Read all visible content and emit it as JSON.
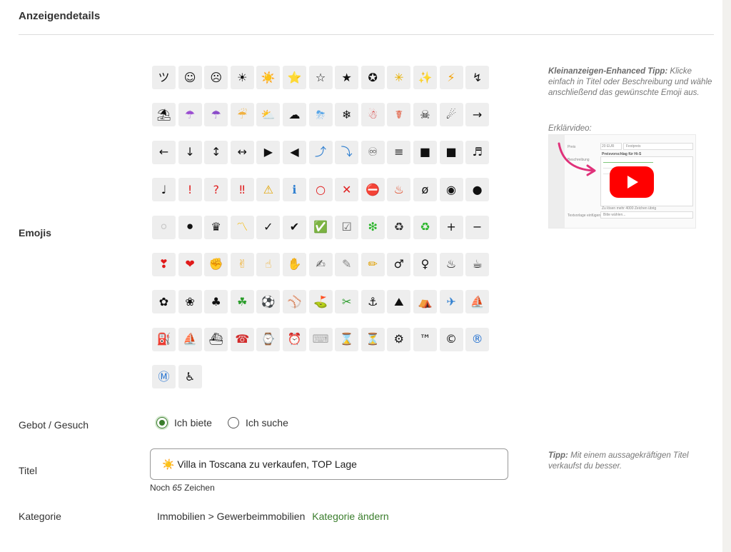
{
  "section": {
    "title": "Anzeigendetails"
  },
  "emojis": {
    "label": "Emojis",
    "items": [
      "ツ",
      "☺",
      "☹",
      "☀",
      "☀️",
      "⭐",
      "☆",
      "★",
      "✪",
      "✳",
      "✨",
      "⚡",
      "↯",
      "⛱",
      "☂",
      "☂",
      "☔",
      "⛅",
      "☁",
      "⛈",
      "❄",
      "☃",
      "☤",
      "☠",
      "☄",
      "→",
      "←",
      "↓",
      "↕",
      "↔",
      "▶",
      "◀",
      "⤴",
      "⤵",
      "♾",
      "≡",
      "■",
      "■",
      "♬",
      "♩",
      "!",
      "?",
      "‼",
      "⚠",
      "ℹ",
      "○",
      "✕",
      "⛔",
      "♨",
      "ø",
      "◉",
      "●",
      "⚪",
      "⚫",
      "♛",
      "〽",
      "✓",
      "✔",
      "✅",
      "☑",
      "❇",
      "♻",
      "♻",
      "+",
      "−",
      "❣",
      "❤",
      "✊",
      "✌",
      "☝",
      "✋",
      "✍",
      "✎",
      "✏",
      "♂",
      "♀",
      "♨",
      "☕",
      "✿",
      "❀",
      "♣",
      "☘",
      "⚽",
      "⚾",
      "⛳",
      "✂",
      "⚓",
      "⛰",
      "⛺",
      "✈",
      "⛵",
      "⛽",
      "⛵",
      "⛴",
      "☎",
      "⌚",
      "⏰",
      "⌨",
      "⌛",
      "⏳",
      "⚙",
      "™",
      "©",
      "®",
      "Ⓜ",
      "♿"
    ],
    "colors": {
      "4": "#f4a300",
      "5": "#f5b800",
      "9": "#e8b000",
      "10": "#f5c400",
      "11": "#f5a000",
      "14": "#9b4dd1",
      "15": "#8a4bc9",
      "16": "#f0b040",
      "17": "#bbbbbb",
      "19": "#5aa7e8",
      "21": "#d22a2a",
      "22": "#e04a2a",
      "32": "#2f7fd0",
      "33": "#2f7fd0",
      "34": "#555555",
      "40": "#e02020",
      "41": "#e02020",
      "42": "#e02020",
      "43": "#e2a400",
      "44": "#2f7fd0",
      "45": "#e02020",
      "46": "#e02020",
      "47": "#e02020",
      "48": "#e0401a",
      "52": "#c9c9c9",
      "55": "#f5b800",
      "58": "#2ab52a",
      "59": "#666666",
      "60": "#2ab52a",
      "61": "#333333",
      "62": "#2ab52a",
      "65": "#e01a1a",
      "66": "#e01a1a",
      "67": "#f0b030",
      "68": "#f0b030",
      "69": "#f0b030",
      "70": "#f0b030",
      "71": "#555555",
      "72": "#888888",
      "73": "#e0a000",
      "81": "#2a9d2a",
      "85": "#2a9d2a",
      "88": "#e05010",
      "89": "#2f7fd0",
      "90": "#d24a10",
      "91": "#d22a2a",
      "92": "#d24a10",
      "94": "#d22a2a",
      "96": "#d22a2a",
      "97": "#aaaaaa",
      "98": "#d08a30",
      "99": "#8a6a20",
      "103": "#1f6fd0",
      "104": "#1f6fd0"
    }
  },
  "tip_emoji": {
    "lead": "Kleinanzeigen-Enhanced Tipp:",
    "text": "Klicke einfach in Titel oder Beschreibung und wähle anschließend das gewünschte Emoji aus.",
    "video_label": "Erklärvideo:"
  },
  "video_preview": {
    "row1_label": "Preis",
    "row1_value": "20 EUR",
    "row1_select": "Festpreis",
    "row2_label": "Beschreibung",
    "row2_heading": "Preisvorschlag für Hi-S",
    "row3_label": "Textvorlage einfügen",
    "row3_select": "Bitte wählen...",
    "hint": "Zu lösen mehr 4000 Zeichen übrig"
  },
  "offer_type": {
    "label": "Gebot / Gesuch",
    "options": [
      "Ich biete",
      "Ich suche"
    ],
    "selected": "Ich biete"
  },
  "title_field": {
    "label": "Titel",
    "value": "☀️ Villa in Toscana zu verkaufen, TOP Lage",
    "counter_prefix": "Noch",
    "counter_number": "65",
    "counter_suffix": "Zeichen"
  },
  "tip_title": {
    "lead": "Tipp:",
    "text": "Mit einem aussagekräftigen Titel verkaufst du besser."
  },
  "category": {
    "label": "Kategorie",
    "path": "Immobilien > Gewerbeimmobilien",
    "change_link": "Kategorie ändern"
  },
  "accent_color": "#3a7d2c"
}
